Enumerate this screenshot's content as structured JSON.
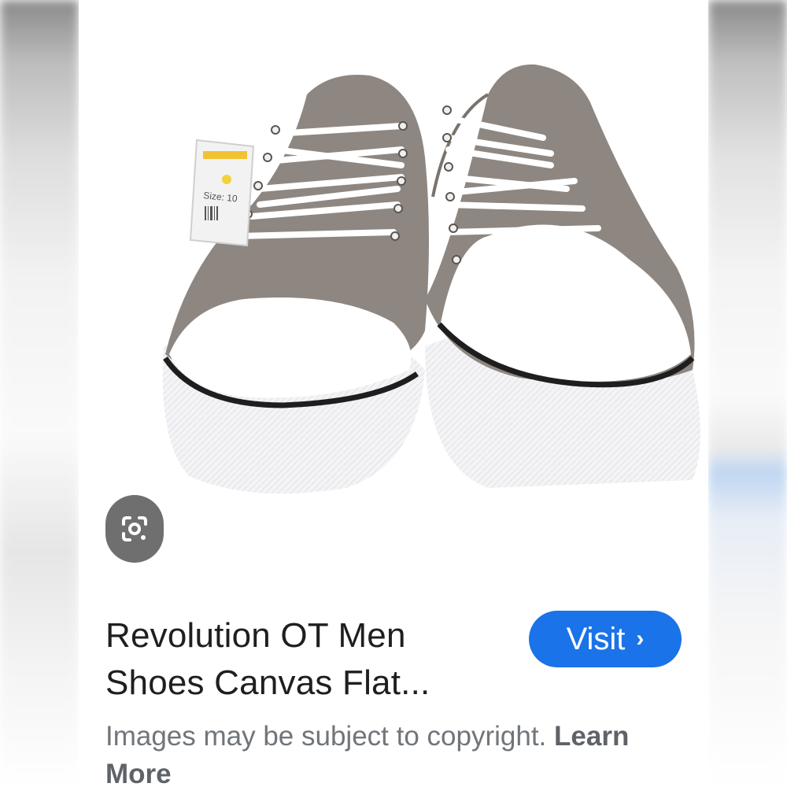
{
  "result": {
    "title_line1": "Revolution OT Men",
    "title_line2": "Shoes Canvas Flat...",
    "visit_label": "Visit",
    "visit_chevron": "›",
    "disclaimer_text": "Images may be subject to copyright.",
    "learn_more_label": "Learn More"
  },
  "image": {
    "tag_text": "Size: 10"
  },
  "icons": {
    "lens": "google-lens-icon",
    "chevron": "chevron-right-icon"
  },
  "colors": {
    "visit_button": "#1a73e8",
    "lens_button": "#6f6f6f",
    "canvas": "#8d8680",
    "title_text": "#1f1f1f",
    "disclaimer_text": "#70757a"
  }
}
